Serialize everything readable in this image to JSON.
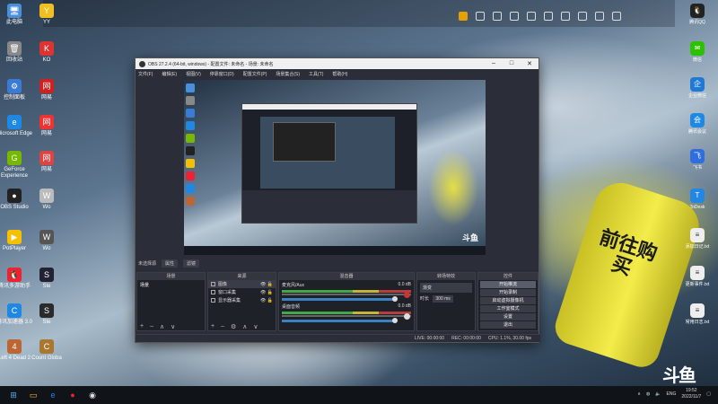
{
  "desktop": {
    "left_icons": [
      {
        "label": "此电脑",
        "color": "#4a90d9",
        "glyph": "🖥"
      },
      {
        "label": "YY",
        "color": "#f0c020",
        "glyph": "Y"
      },
      {
        "label": "回收站",
        "color": "#888",
        "glyph": "🗑"
      },
      {
        "label": "KO",
        "color": "#d33",
        "glyph": "K"
      },
      {
        "label": "控制面板",
        "color": "#3a7bd5",
        "glyph": "⚙"
      },
      {
        "label": "网易",
        "color": "#c22",
        "glyph": "网"
      },
      {
        "label": "Microsoft Edge",
        "color": "#1e88e5",
        "glyph": "e"
      },
      {
        "label": "网易",
        "color": "#e33",
        "glyph": "网"
      },
      {
        "label": "GeForce Experience",
        "color": "#76b900",
        "glyph": "G"
      },
      {
        "label": "网易",
        "color": "#d44",
        "glyph": "网"
      },
      {
        "label": "OBS Studio",
        "color": "#222",
        "glyph": "●"
      },
      {
        "label": "Wo",
        "color": "#bbb",
        "glyph": "W"
      },
      {
        "label": "PotPlayer",
        "color": "#f5c000",
        "glyph": "▶"
      },
      {
        "label": "Wo",
        "color": "#555",
        "glyph": "W"
      },
      {
        "label": "腾讯多游助手",
        "color": "#e23",
        "glyph": "🐧"
      },
      {
        "label": "Ste",
        "color": "#223",
        "glyph": "S"
      },
      {
        "label": "腾讯加速器 3.0",
        "color": "#1e88e5",
        "glyph": "C"
      },
      {
        "label": "Ste",
        "color": "#2a2a2a",
        "glyph": "S"
      },
      {
        "label": "Left 4 Dead 2",
        "color": "#b63",
        "glyph": "4"
      },
      {
        "label": "Count Globa",
        "color": "#a73",
        "glyph": "C"
      }
    ],
    "right_icons": [
      {
        "label": "腾讯QQ",
        "color": "#222",
        "glyph": "🐧"
      },
      {
        "label": "微信",
        "color": "#2dc100",
        "glyph": "✉"
      },
      {
        "label": "企业微信",
        "color": "#1f7ad6",
        "glyph": "企"
      },
      {
        "label": "腾讯会议",
        "color": "#1e88e5",
        "glyph": "会"
      },
      {
        "label": "飞书",
        "color": "#2f6de0",
        "glyph": "飞"
      },
      {
        "label": "ToDesk",
        "color": "#2286e6",
        "glyph": "T"
      },
      {
        "label": "添加日记.txt",
        "color": "#eee",
        "glyph": "≡"
      },
      {
        "label": "更新事件.txt",
        "color": "#eee",
        "glyph": "≡"
      },
      {
        "label": "常用日志.txt",
        "color": "#eee",
        "glyph": "≡"
      }
    ],
    "bottle_text": "前往购买",
    "watermark": "斗鱼"
  },
  "obs": {
    "title": "OBS 27.2.4 (64-bit, windows) - 配置文件: 未命名 - 场景: 未命名",
    "menu": [
      "文件(F)",
      "编辑(E)",
      "视图(V)",
      "停靠窗口(D)",
      "配置文件(P)",
      "场景集合(S)",
      "工具(T)",
      "帮助(H)"
    ],
    "scene_bar": {
      "label": "未选择源",
      "btn1": "属性",
      "btn2": "滤镜"
    },
    "scenes": {
      "header": "场景",
      "items": [
        "场景"
      ]
    },
    "sources": {
      "header": "来源",
      "items": [
        "图像",
        "窗口采集",
        "显示器采集"
      ]
    },
    "mixer": {
      "header": "混音器",
      "channels": [
        {
          "name": "麦克风/Aux",
          "db": "0.0 dB",
          "muted": true
        },
        {
          "name": "桌面音频",
          "db": "0.0 dB",
          "muted": false
        }
      ]
    },
    "transitions": {
      "header": "转场特效",
      "type": "渐变",
      "duration_label": "时长",
      "duration": "300 ms"
    },
    "controls": {
      "header": "控件",
      "buttons": [
        "开始推流",
        "开始录制",
        "启动虚拟摄像机",
        "工作室模式",
        "设置",
        "退出"
      ]
    },
    "status": {
      "live": "LIVE: 00:00:00",
      "rec": "REC: 00:00:00",
      "cpu": "CPU: 1.1%, 30.00 fps"
    }
  },
  "taskbar": {
    "lang": "ENG",
    "time": "19:52",
    "date": "2022/11/7"
  }
}
